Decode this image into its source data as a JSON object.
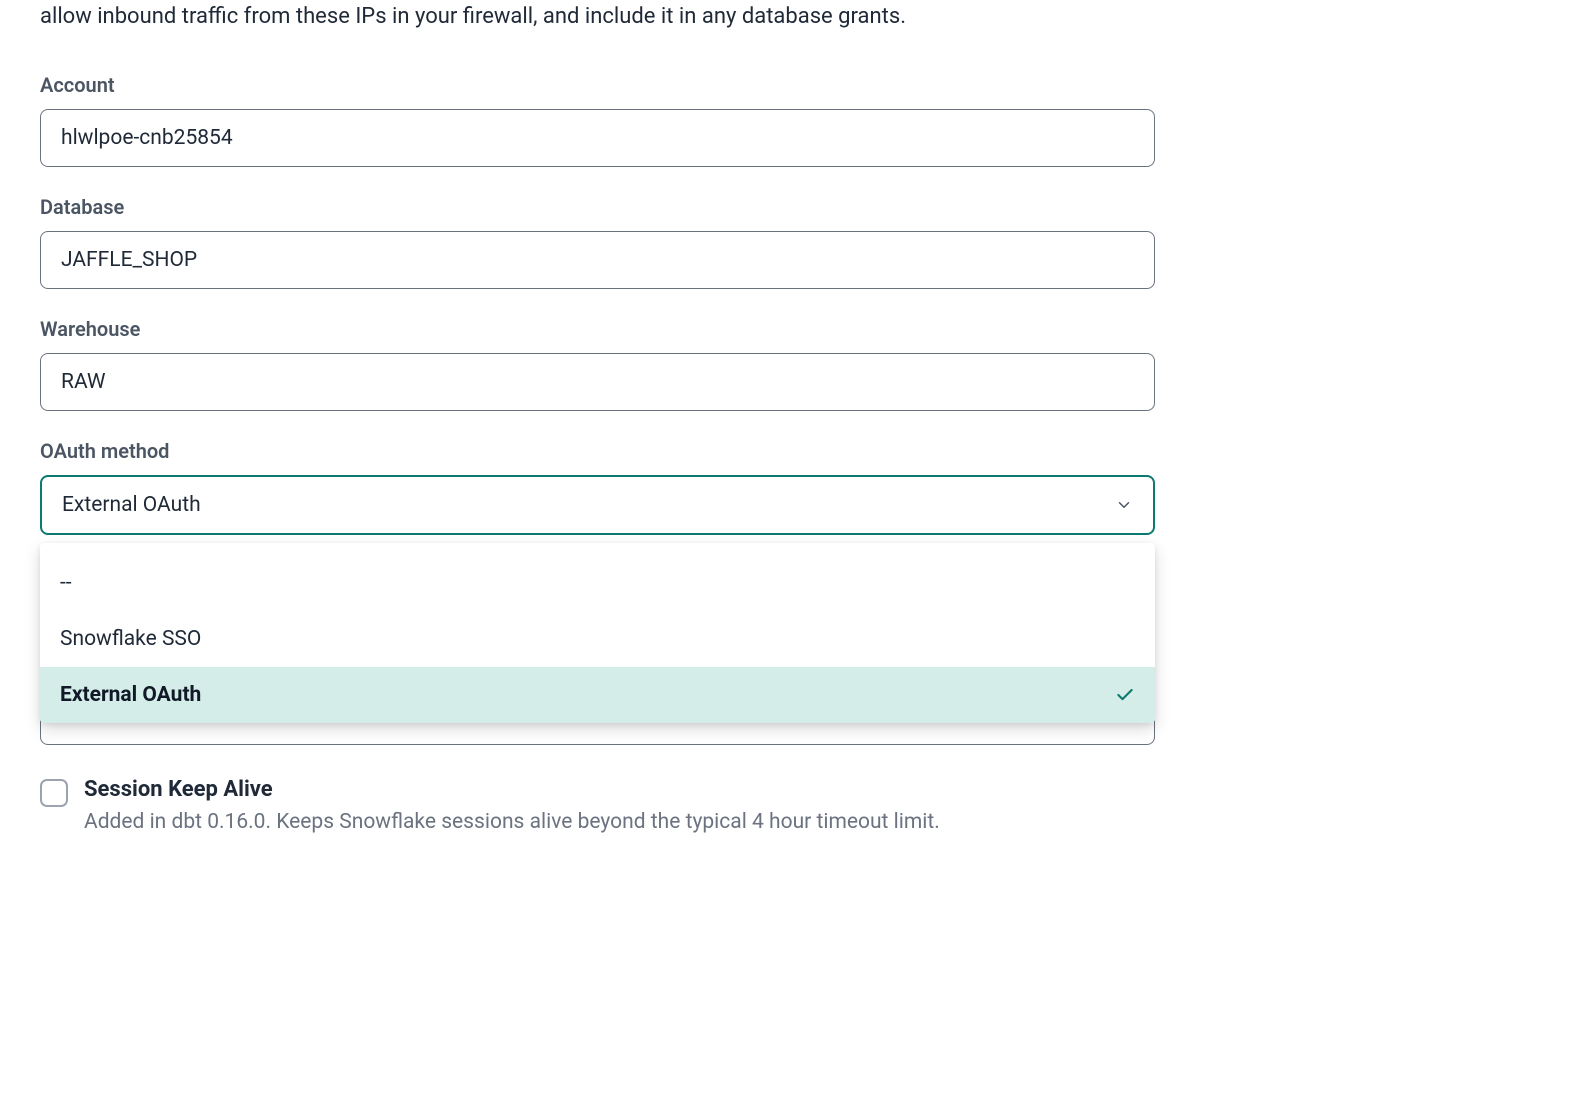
{
  "intro": {
    "text": "allow inbound traffic from these IPs in your firewall, and include it in any database grants."
  },
  "form": {
    "account": {
      "label": "Account",
      "value": "hlwlpoe-cnb25854"
    },
    "database": {
      "label": "Database",
      "value": "JAFFLE_SHOP"
    },
    "warehouse": {
      "label": "Warehouse",
      "value": "RAW"
    },
    "oauth_method": {
      "label": "OAuth method",
      "selected": "External OAuth",
      "options": [
        {
          "label": "--",
          "selected": false
        },
        {
          "label": "Snowflake SSO",
          "selected": false
        },
        {
          "label": "External OAuth",
          "selected": true
        }
      ]
    },
    "session_keep_alive": {
      "label": "Session Keep Alive",
      "description": "Added in dbt 0.16.0. Keeps Snowflake sessions alive beyond the typical 4 hour timeout limit.",
      "checked": false
    }
  }
}
